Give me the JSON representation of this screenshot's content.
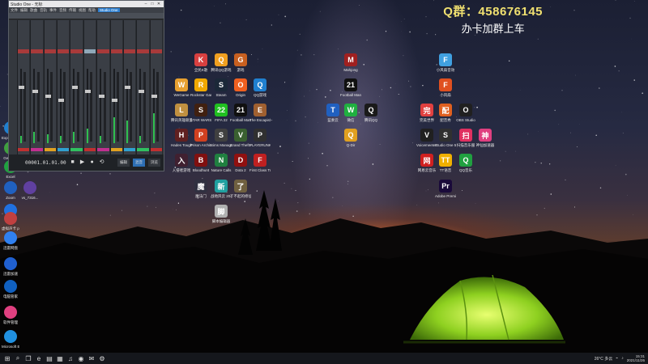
{
  "overlay": {
    "line1": "Q群：458676145",
    "line2": "办卡加群上车"
  },
  "daw": {
    "title": "Studio One - 无标",
    "menu": [
      "文件",
      "编辑",
      "歌曲",
      "音轨",
      "事件",
      "音频",
      "传输",
      "视图",
      "帮助"
    ],
    "menu_highlight": "Studio One",
    "time": "00001.01.01.00",
    "tabs": [
      "编辑",
      "混音",
      "浏览"
    ],
    "levels": [
      0.1,
      0.15,
      0.12,
      0.1,
      0.15,
      0.2,
      0.1,
      0.35,
      0.3,
      0.1,
      0.4
    ]
  },
  "desktop_icons": [
    {
      "label": "全民K歌",
      "color": "#d84040",
      "glyph": "K"
    },
    {
      "label": "腾讯QQ游戏",
      "color": "#f0a020",
      "glyph": "Q"
    },
    {
      "label": "游戏",
      "color": "#c86020",
      "glyph": "G"
    },
    {
      "label": "WeGame",
      "color": "#e8a030",
      "glyph": "W"
    },
    {
      "label": "Rockstar Games",
      "color": "#f0a800",
      "glyph": "R"
    },
    {
      "label": "Steam",
      "color": "#1b2838",
      "glyph": "S"
    },
    {
      "label": "Origin",
      "color": "#f06020",
      "glyph": "O"
    },
    {
      "label": "QQ游戏",
      "color": "#2080d0",
      "glyph": "Q"
    },
    {
      "label": "腾讯英雄联盟",
      "color": "#c09040",
      "glyph": "L"
    },
    {
      "label": "STAR WARS",
      "color": "#402010",
      "glyph": "S"
    },
    {
      "label": "FIFA 22",
      "color": "#20c020",
      "glyph": "22"
    },
    {
      "label": "Football Manager",
      "color": "#101010",
      "glyph": "21"
    },
    {
      "label": "The Escapists 2",
      "color": "#a06030",
      "glyph": "E"
    },
    {
      "label": "Hades Tough Life",
      "color": "#602020",
      "glyph": "H"
    },
    {
      "label": "Prison Architect",
      "color": "#d04020",
      "glyph": "P"
    },
    {
      "label": "Sims Manager",
      "color": "#404040",
      "glyph": "S"
    },
    {
      "label": "Grand Theft Auto V",
      "color": "#3a6030",
      "glyph": "V"
    },
    {
      "label": "PLAYERUNKNOWN'S BATTLEGROUNDS",
      "color": "#303030",
      "glyph": "P"
    },
    {
      "label": "入侵者游戏",
      "color": "#402030",
      "glyph": "入"
    },
    {
      "label": "Bloodhunt",
      "color": "#801010",
      "glyph": "B"
    },
    {
      "label": "Nature Calls",
      "color": "#208040",
      "glyph": "N"
    },
    {
      "label": "Dota 2",
      "color": "#901010",
      "glyph": "D"
    },
    {
      "label": "First Class Trouble",
      "color": "#c02020",
      "glyph": "F"
    },
    {
      "label": "魔法门",
      "color": "#303040",
      "glyph": "魔"
    },
    {
      "label": "战地风云 2042",
      "color": "#20a0a0",
      "glyph": "新"
    },
    {
      "label": "了不起的修仙模拟器",
      "color": "#706040",
      "glyph": "了"
    },
    {
      "label": "脚本编辑器",
      "color": "#b0b0b0",
      "glyph": "脚"
    },
    {
      "label": "Mahjong",
      "color": "#a02020",
      "glyph": "M"
    },
    {
      "label": "Football Manager",
      "color": "#101010",
      "glyph": "21"
    },
    {
      "label": "蓝奏云",
      "color": "#2060c0",
      "glyph": "T"
    },
    {
      "label": "微信",
      "color": "#20b040",
      "glyph": "W"
    },
    {
      "label": "腾讯QQ",
      "color": "#1a1a1a",
      "glyph": "Q"
    },
    {
      "label": "Q-Dir",
      "color": "#e0a020",
      "glyph": "Q"
    },
    {
      "label": "小风扇音效",
      "color": "#40a0e0",
      "glyph": "F"
    },
    {
      "label": "小风扇",
      "color": "#e05020",
      "glyph": "F"
    },
    {
      "label": "完美世界",
      "color": "#e04040",
      "glyph": "完"
    },
    {
      "label": "配音秀",
      "color": "#e06020",
      "glyph": "配"
    },
    {
      "label": "OBS Studio",
      "color": "#202020",
      "glyph": "O"
    },
    {
      "label": "Voicemeeter Banana",
      "color": "#202020",
      "glyph": "V"
    },
    {
      "label": "Studio One 5",
      "color": "#303030",
      "glyph": "S"
    },
    {
      "label": "扫描音乐服",
      "color": "#e03060",
      "glyph": "扫"
    },
    {
      "label": "神仙加速器",
      "color": "#e04080",
      "glyph": "神"
    },
    {
      "label": "网易云音乐",
      "color": "#d02020",
      "glyph": "网"
    },
    {
      "label": "TT语音",
      "color": "#f0b000",
      "glyph": "TT"
    },
    {
      "label": "QQ音乐",
      "color": "#20a040",
      "glyph": "Q"
    },
    {
      "label": "Adobe Premiere",
      "color": "#1a0a3a",
      "glyph": "Pr"
    }
  ],
  "left_icons": [
    {
      "label": "Experience",
      "color": "#2080d0"
    },
    {
      "label": "GeForce",
      "color": "#40a040"
    },
    {
      "label": "Excel",
      "color": "#20a040"
    },
    {
      "label": "Zoom",
      "color": "#2060c0"
    },
    {
      "label": "vs_7316...",
      "color": "#6040a0"
    },
    {
      "label": "迅雷",
      "color": "#2070e0"
    },
    {
      "label": "虚拟声卡 png",
      "color": "#c04040"
    },
    {
      "label": "迅雷网盘",
      "color": "#3080f0"
    },
    {
      "label": "迅雷加速",
      "color": "#2060d0"
    },
    {
      "label": "电脑管家",
      "color": "#1060c0"
    },
    {
      "label": "软件管理",
      "color": "#e04080"
    },
    {
      "label": "Microsoft Edge",
      "color": "#2090e0"
    }
  ],
  "taskbar": {
    "items": [
      "start",
      "search",
      "task-view",
      "edge",
      "explorer",
      "store",
      "studio-one",
      "obs",
      "wechat",
      "settings"
    ],
    "weather": "26°C 多云",
    "time": "15:31",
    "date": "2021/11/26"
  }
}
